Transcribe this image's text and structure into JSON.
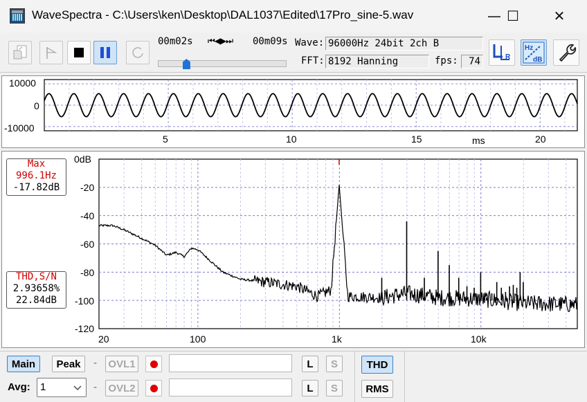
{
  "window": {
    "title": "WaveSpectra - C:\\Users\\ken\\Desktop\\DAL1037\\Edited\\17Pro_sine-5.wav",
    "minimize_glyph": "—",
    "maximize_glyph": "☐",
    "close_glyph": "✕"
  },
  "toolbar": {
    "time_start": "00m02s",
    "time_end": "00m09s",
    "transport_glyph": "⏮◀▶⏭",
    "wave_label": "Wave:",
    "wave_value": "96000Hz 24bit 2ch B",
    "fft_label": "FFT:",
    "fft_value": "8192 Hanning",
    "fps_label": "fps:",
    "fps_value": "74",
    "position_fraction": 0.22
  },
  "waveform": {
    "y_ticks": [
      "10000",
      "0",
      "-10000"
    ],
    "x_ticks": [
      "5",
      "10",
      "15",
      "20"
    ],
    "x_unit": "ms"
  },
  "spectrum": {
    "y_ticks": [
      "0dB",
      "-20",
      "-40",
      "-60",
      "-80",
      "-100",
      "-120"
    ],
    "x_ticks": [
      "20",
      "100",
      "1k",
      "10k"
    ],
    "max_panel": {
      "title": "Max",
      "freq": "996.1Hz",
      "level": "-17.82dB"
    },
    "thd_panel": {
      "title": "THD,S/N",
      "thd": "2.93658%",
      "sn": "22.84dB"
    }
  },
  "bottom": {
    "main_label": "Main",
    "peak_label": "Peak",
    "dash": "-",
    "ovl1_label": "OVL1",
    "ovl2_label": "OVL2",
    "l_label": "L",
    "s_label": "S",
    "thd_label": "THD",
    "rms_label": "RMS",
    "avg_label": "Avg:",
    "avg_value": "1"
  },
  "chart_data": [
    {
      "type": "line",
      "title": "",
      "xlabel": "ms",
      "ylabel": "",
      "xlim": [
        0,
        21.5
      ],
      "ylim": [
        -12000,
        12000
      ],
      "series": [
        {
          "frequency_hz": 996.1,
          "amplitude": 5400
        }
      ]
    },
    {
      "type": "line",
      "title": "",
      "xlabel": "",
      "ylabel": "",
      "xscale": "log",
      "xlim": [
        20,
        48000
      ],
      "ylim": [
        -120,
        0
      ],
      "grid": true,
      "x": [
        20,
        25,
        30,
        40,
        50,
        60,
        70,
        80,
        90,
        100,
        150,
        200,
        300,
        500,
        700,
        900,
        996,
        1100,
        2000,
        3000,
        5000,
        10000,
        20000,
        48000
      ],
      "series": [
        {
          "values": [
            -47,
            -47,
            -50,
            -56,
            -61,
            -68,
            -66,
            -69,
            -63,
            -64,
            -80,
            -85,
            -87,
            -90,
            -97,
            -92,
            -18,
            -97,
            -98,
            -95,
            -98,
            -99,
            -102,
            -103
          ]
        }
      ],
      "harmonic_peaks": [
        [
          1992,
          -84
        ],
        [
          2988,
          -44
        ],
        [
          3984,
          -84
        ],
        [
          4980,
          -65
        ],
        [
          5976,
          -75
        ],
        [
          6972,
          -84
        ],
        [
          7968,
          -90
        ],
        [
          8964,
          -91
        ],
        [
          9960,
          -80
        ],
        [
          10956,
          -98
        ],
        [
          11952,
          -95
        ],
        [
          12948,
          -87
        ],
        [
          13944,
          -91
        ],
        [
          14940,
          -94
        ],
        [
          15936,
          -90
        ],
        [
          16932,
          -89
        ],
        [
          17928,
          -91
        ],
        [
          18924,
          -80
        ],
        [
          19920,
          -87
        ]
      ]
    }
  ]
}
